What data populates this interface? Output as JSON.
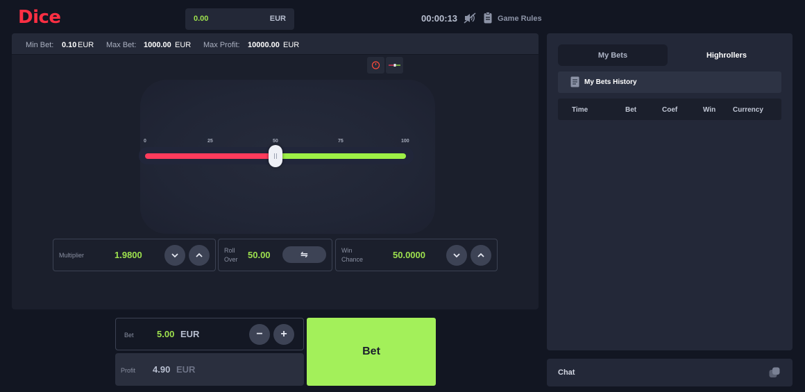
{
  "header": {
    "logo": "Dice",
    "balance": {
      "amount": "0.00",
      "currency": "EUR"
    },
    "timer": "00:00:13",
    "sound_icon": "sound-off-icon",
    "rules_icon": "document-icon",
    "rules_label": "Game Rules"
  },
  "limits": {
    "min_label": "Min Bet:",
    "min_value": "0.10",
    "min_cur": "EUR",
    "max_label": "Max Bet:",
    "max_value": "1000.00",
    "max_cur": "EUR",
    "profit_label": "Max Profit:",
    "profit_value": "10000.00",
    "profit_cur": "EUR"
  },
  "slider": {
    "scale": [
      "0",
      "25",
      "50",
      "75",
      "100"
    ],
    "value": 50,
    "lose_color": "#ff3b5c",
    "win_color": "#9ef046"
  },
  "controls": {
    "multiplier_label": "Multiplier",
    "multiplier_value": "1.9800",
    "roll_label_1": "Roll",
    "roll_label_2": "Over",
    "roll_value": "50.00",
    "swap_symbol": "⇋",
    "chance_label_1": "Win",
    "chance_label_2": "Chance",
    "chance_value": "50.0000"
  },
  "bet": {
    "label": "Bet",
    "amount": "5.00",
    "currency": "EUR",
    "minus": "−",
    "plus": "+",
    "profit_label": "Profit",
    "profit_amount": "4.90",
    "profit_currency": "EUR",
    "button": "Bet"
  },
  "side": {
    "tabs": [
      "My Bets",
      "Highrollers"
    ],
    "history_label": "My Bets History",
    "columns": [
      "Time",
      "Bet",
      "Coef",
      "Win",
      "Currency"
    ]
  },
  "chat": {
    "label": "Chat"
  },
  "colors": {
    "accent": "#9ee24e",
    "brand": "#ff2f43",
    "bet_button": "#a3f05a"
  }
}
